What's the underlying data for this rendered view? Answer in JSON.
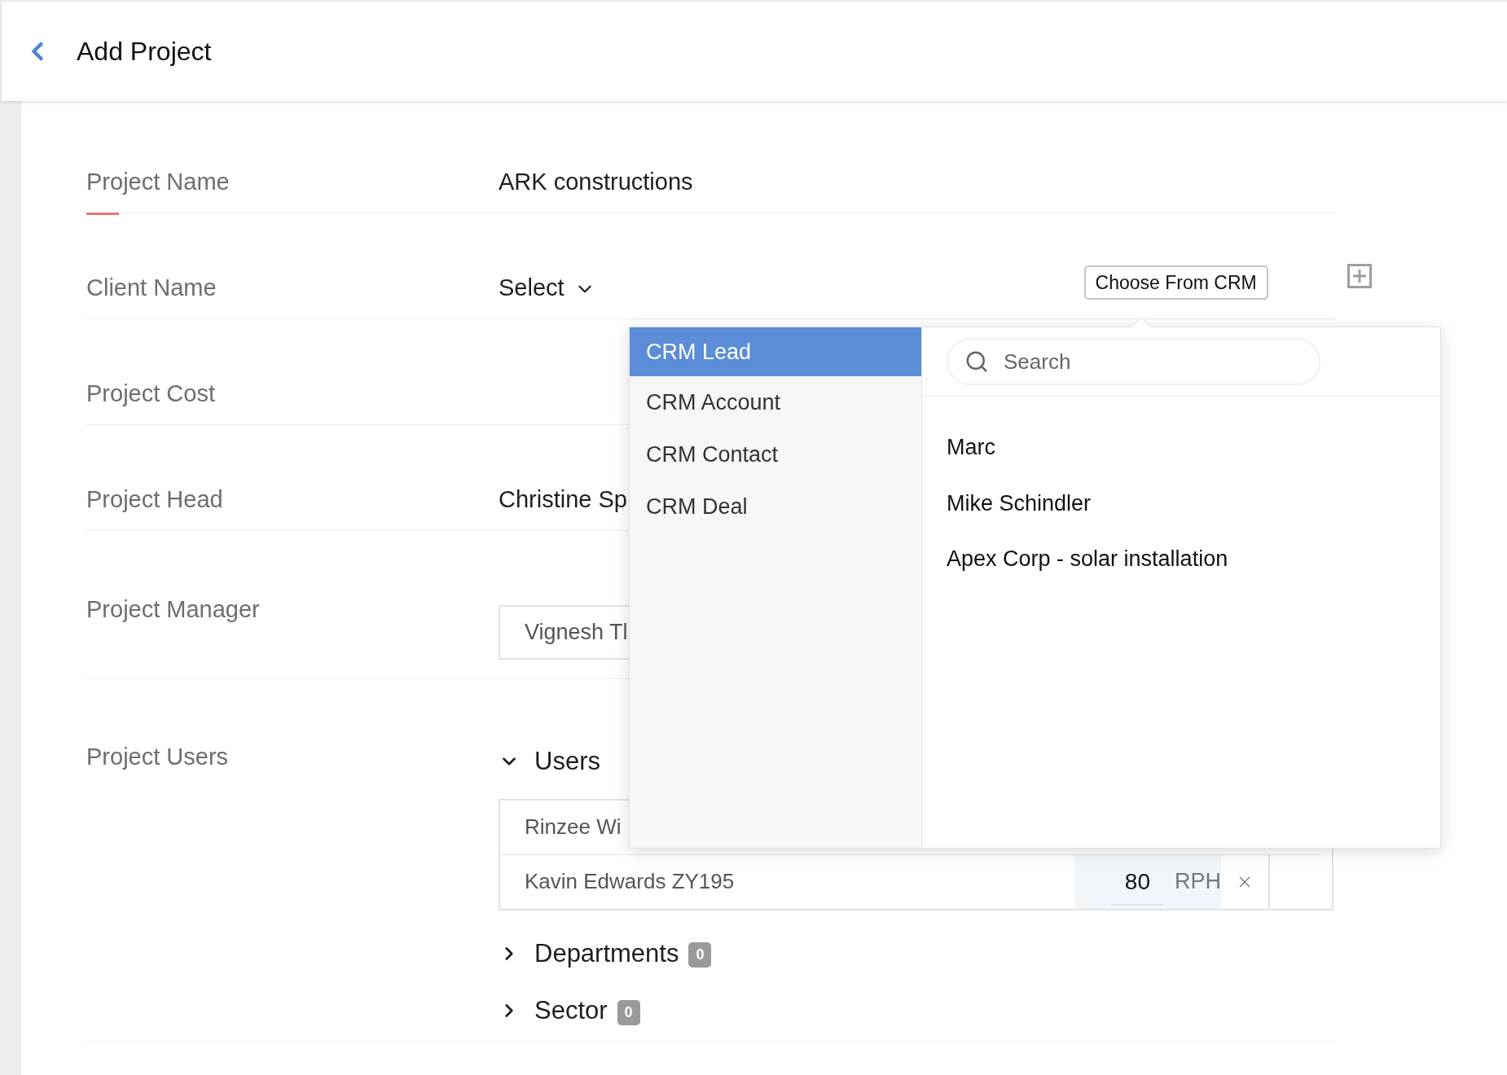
{
  "header": {
    "title": "Add Project"
  },
  "fields": [
    {
      "kind": "text",
      "label": "Project Name",
      "value": "ARK constructions",
      "active": true
    },
    {
      "kind": "select",
      "label": "Client Name",
      "value": "Select",
      "button": "Choose From CRM",
      "active": false
    },
    {
      "kind": "empty",
      "label": "Project Cost",
      "active": false
    },
    {
      "kind": "text",
      "label": "Project Head",
      "value": "Christine Sp",
      "active": false
    },
    {
      "kind": "input",
      "label": "Project Manager",
      "value": "Vignesh Tl",
      "active": false
    },
    {
      "kind": "users",
      "label": "Project Users",
      "active": false
    }
  ],
  "users": {
    "label": "Users",
    "expanded": true,
    "rows": [
      {
        "name": "Rinzee Wi"
      },
      {
        "name": "Kavin Edwards ZY195",
        "rate": "80",
        "unit": "RPH"
      }
    ]
  },
  "groups": [
    {
      "label": "Departments",
      "count": "0",
      "expanded": false
    },
    {
      "label": "Sector",
      "count": "0",
      "expanded": false
    }
  ],
  "popover": {
    "categories": [
      {
        "label": "CRM Lead",
        "selected": true
      },
      {
        "label": "CRM Account",
        "selected": false
      },
      {
        "label": "CRM Contact",
        "selected": false
      },
      {
        "label": "CRM Deal",
        "selected": false
      }
    ],
    "search": {
      "placeholder": "Search"
    },
    "results": [
      "Marc",
      "Mike Schindler",
      "Apex Corp - solar installation"
    ]
  }
}
